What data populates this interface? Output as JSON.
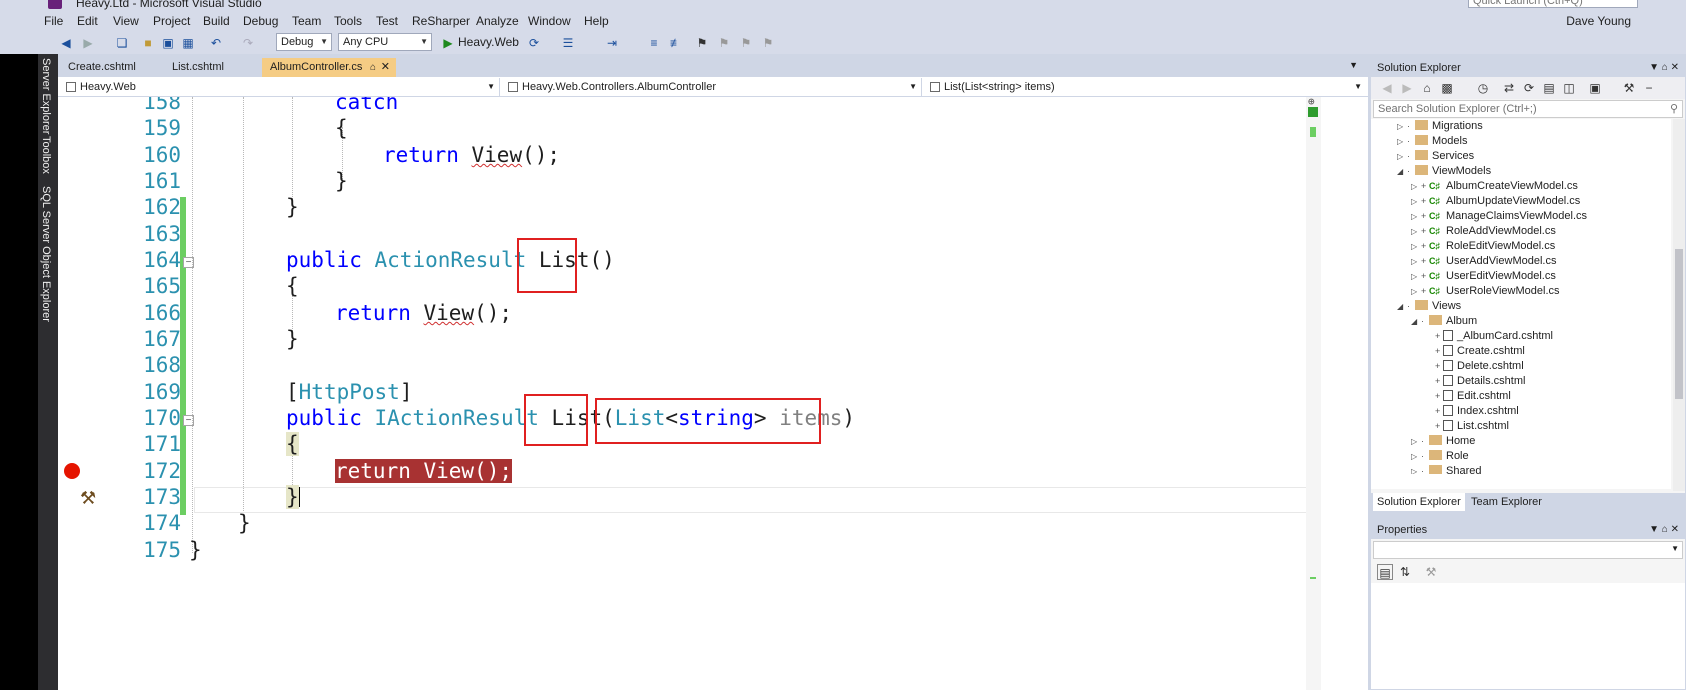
{
  "window": {
    "title": "Heavy.Ltd - Microsoft Visual Studio",
    "quick_launch_placeholder": "Quick Launch (Ctrl+Q)",
    "user": "Dave Young"
  },
  "menu": [
    "File",
    "Edit",
    "View",
    "Project",
    "Build",
    "Debug",
    "Team",
    "Tools",
    "Test",
    "ReSharper",
    "Analyze",
    "Window",
    "Help"
  ],
  "toolbar": {
    "config": "Debug",
    "platform": "Any CPU",
    "start_target": "Heavy.Web"
  },
  "left_strip": [
    "Server Explorer",
    "Toolbox",
    "SQL Server Object Explorer"
  ],
  "tabs": [
    {
      "label": "Create.cshtml",
      "active": false
    },
    {
      "label": "List.cshtml",
      "active": false
    },
    {
      "label": "AlbumController.cs",
      "active": true
    }
  ],
  "navbar": {
    "project": "Heavy.Web",
    "type": "Heavy.Web.Controllers.AlbumController",
    "member": "List(List<string> items)"
  },
  "editor": {
    "line_numbers": [
      "158",
      "159",
      "160",
      "161",
      "162",
      "163",
      "164",
      "165",
      "166",
      "167",
      "168",
      "169",
      "170",
      "171",
      "172",
      "173",
      "174",
      "175"
    ],
    "code": {
      "l158": "catch",
      "l159": "{",
      "l160_kw": "return",
      "l160_fn": "View",
      "l160_tail": "();",
      "l161": "}",
      "l162": "}",
      "l164_kw": "public",
      "l164_type": "ActionResult",
      "l164_fn": "List",
      "l164_tail": "()",
      "l165": "{",
      "l166_kw": "return",
      "l166_fn": "View",
      "l166_tail": "();",
      "l167": "}",
      "l169_open": "[",
      "l169_attr": "HttpPost",
      "l169_close": "]",
      "l170_kw": "public",
      "l170_type": "IActionResult",
      "l170_fn": "List",
      "l170_paren": "(",
      "l170_ptype": "List",
      "l170_lt": "<",
      "l170_str": "string",
      "l170_gt": ">",
      "l170_param": "items",
      "l170_close": ")",
      "l171": "{",
      "l172": "return View();",
      "l173": "}",
      "l174": "}",
      "l175": "}"
    }
  },
  "solution_explorer": {
    "title": "Solution Explorer",
    "search_placeholder": "Search Solution Explorer (Ctrl+;)",
    "items": [
      {
        "label": "Migrations",
        "kind": "folder"
      },
      {
        "label": "Models",
        "kind": "folder"
      },
      {
        "label": "Services",
        "kind": "folder"
      },
      {
        "label": "ViewModels",
        "kind": "folder-open"
      },
      {
        "label": "AlbumCreateViewModel.cs",
        "kind": "cs"
      },
      {
        "label": "AlbumUpdateViewModel.cs",
        "kind": "cs"
      },
      {
        "label": "ManageClaimsViewModel.cs",
        "kind": "cs"
      },
      {
        "label": "RoleAddViewModel.cs",
        "kind": "cs"
      },
      {
        "label": "RoleEditViewModel.cs",
        "kind": "cs"
      },
      {
        "label": "UserAddViewModel.cs",
        "kind": "cs"
      },
      {
        "label": "UserEditViewModel.cs",
        "kind": "cs"
      },
      {
        "label": "UserRoleViewModel.cs",
        "kind": "cs"
      },
      {
        "label": "Views",
        "kind": "folder-open"
      },
      {
        "label": "Album",
        "kind": "folder-open"
      },
      {
        "label": "_AlbumCard.cshtml",
        "kind": "cshtml"
      },
      {
        "label": "Create.cshtml",
        "kind": "cshtml"
      },
      {
        "label": "Delete.cshtml",
        "kind": "cshtml"
      },
      {
        "label": "Details.cshtml",
        "kind": "cshtml"
      },
      {
        "label": "Edit.cshtml",
        "kind": "cshtml"
      },
      {
        "label": "Index.cshtml",
        "kind": "cshtml"
      },
      {
        "label": "List.cshtml",
        "kind": "cshtml"
      },
      {
        "label": "Home",
        "kind": "folder"
      },
      {
        "label": "Role",
        "kind": "folder"
      },
      {
        "label": "Shared",
        "kind": "folder"
      }
    ],
    "bottom_tabs": [
      "Solution Explorer",
      "Team Explorer"
    ]
  },
  "properties": {
    "title": "Properties"
  },
  "colors": {
    "keyword": "#0000ff",
    "type": "#2b91af",
    "line_number": "#2b91af",
    "breakpoint": "#e51400",
    "breakpoint_highlight": "#a83232",
    "change_bar": "#6cce62",
    "annotation_box": "#e02020",
    "active_tab": "#f5cc84"
  }
}
